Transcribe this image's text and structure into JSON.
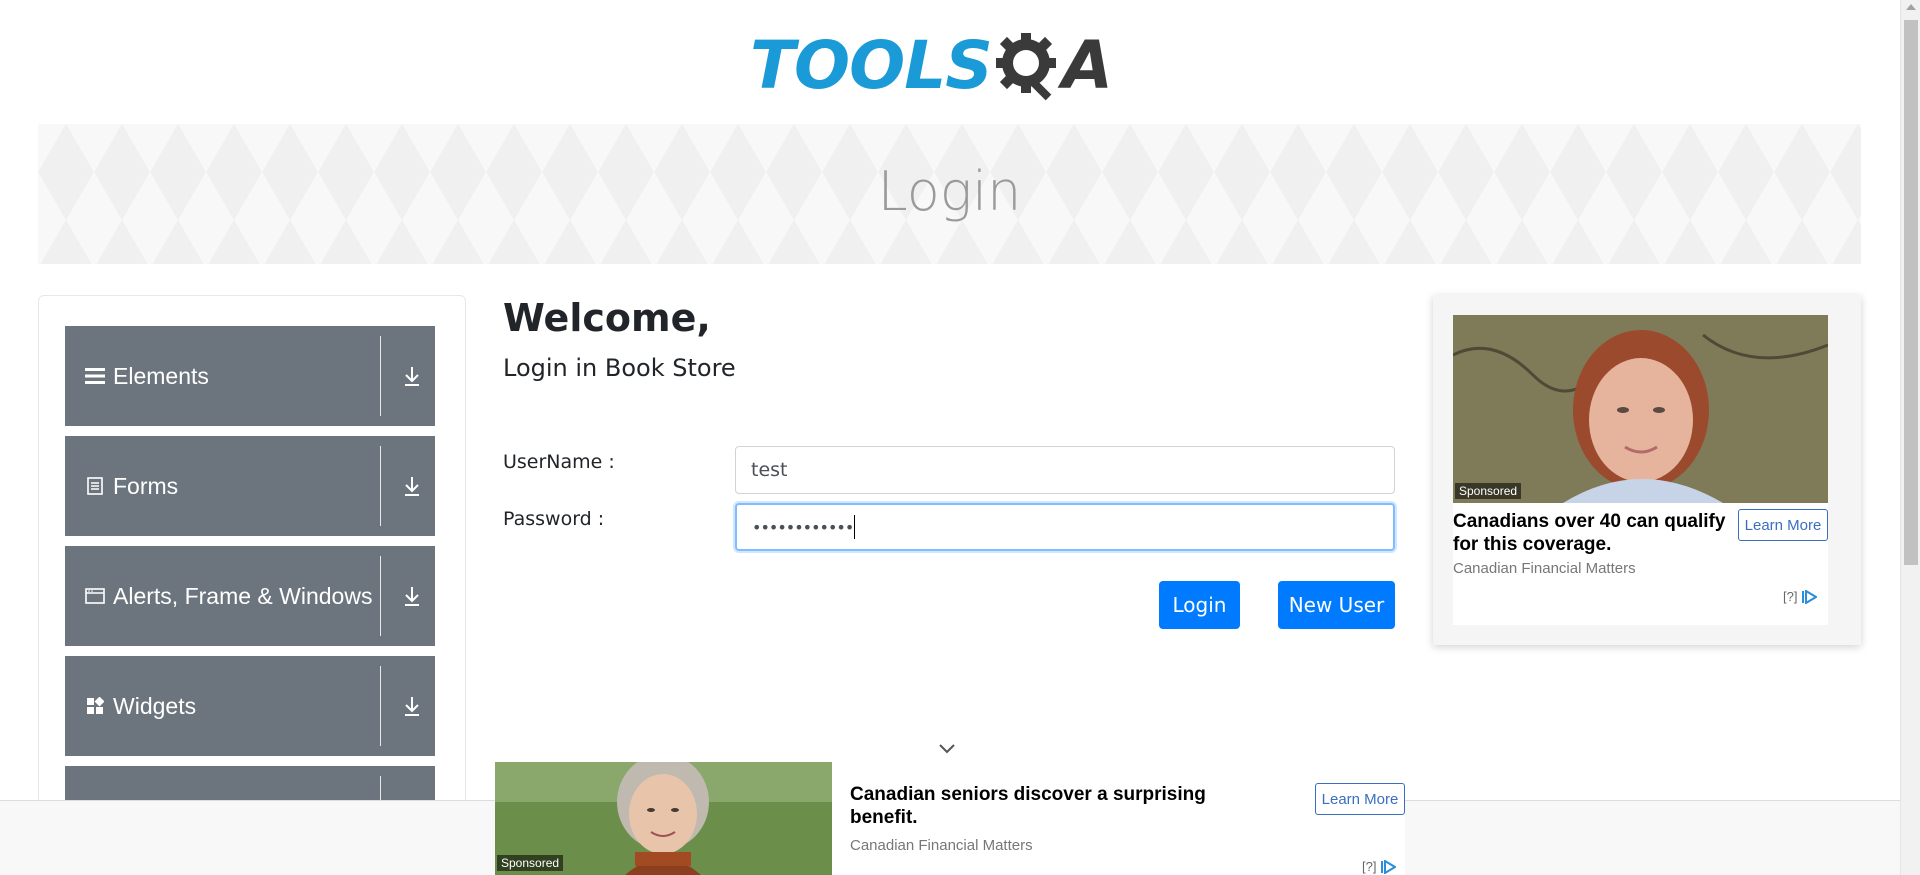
{
  "logo": {
    "text_tools": "TOOLS",
    "text_a": "A"
  },
  "banner": {
    "title": "Login"
  },
  "nav": {
    "groups": [
      {
        "label": "Elements",
        "icon": "hamburger-icon"
      },
      {
        "label": "Forms",
        "icon": "document-icon"
      },
      {
        "label": "Alerts, Frame & Windows",
        "icon": "window-icon"
      },
      {
        "label": "Widgets",
        "icon": "widgets-icon"
      }
    ]
  },
  "form": {
    "welcome": "Welcome,",
    "subtitle": "Login in Book Store",
    "username_label": "UserName :",
    "username_value": "test",
    "password_label": "Password :",
    "password_masked": "••••••••••••",
    "login_button": "Login",
    "new_user_button": "New User"
  },
  "ad_right": {
    "sponsored": "Sponsored",
    "headline": "Canadians over 40 can qualify for this coverage.",
    "source": "Canadian Financial Matters",
    "learn_more": "Learn More",
    "help": "[?]"
  },
  "ad_bottom": {
    "sponsored": "Sponsored",
    "headline": "Canadian seniors discover a surprising benefit.",
    "source": "Canadian Financial Matters",
    "learn_more": "Learn More",
    "help": "[?]"
  },
  "colors": {
    "brand_blue": "#1a9ad6",
    "nav_gray": "#6c757d",
    "button_blue": "#007bff"
  }
}
